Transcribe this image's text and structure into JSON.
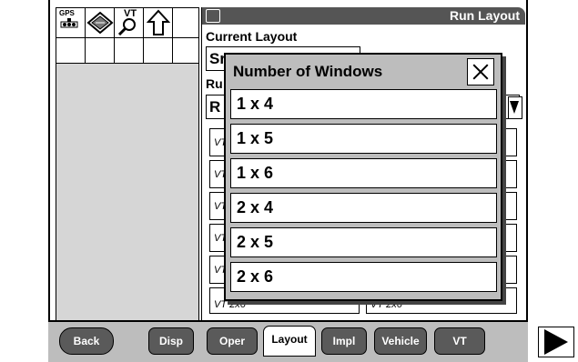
{
  "icon_bar": {
    "gps_label": "GPS",
    "vt_label": "VT",
    "icons": [
      "gps-receiver-icon",
      "book-icon",
      "magnifier-icon",
      "up-arrow-icon"
    ]
  },
  "main": {
    "title": "Run Layout",
    "current_layout_label": "Current Layout",
    "current_layout_value": "Sr",
    "run_label": "Ru",
    "run_value": "R",
    "grid_rows": [
      [
        "VT",
        ""
      ],
      [
        "VT",
        ""
      ],
      [
        "VT",
        ""
      ],
      [
        "VT",
        ""
      ],
      [
        "VT",
        ""
      ],
      [
        "VT",
        ""
      ],
      [
        "VT 2x6",
        "VT 2x6"
      ]
    ]
  },
  "popup": {
    "title": "Number of Windows",
    "options": [
      "1 x 4",
      "1 x 5",
      "1 x 6",
      "2 x 4",
      "2 x 5",
      "2 x 6"
    ]
  },
  "nav": {
    "back": "Back",
    "disp": "Disp",
    "oper": "Oper",
    "layout": "Layout",
    "impl": "Impl",
    "vehicle": "Vehicle",
    "vt": "VT",
    "next_icon": "play-arrow-icon",
    "selected_tab": "Layout"
  }
}
